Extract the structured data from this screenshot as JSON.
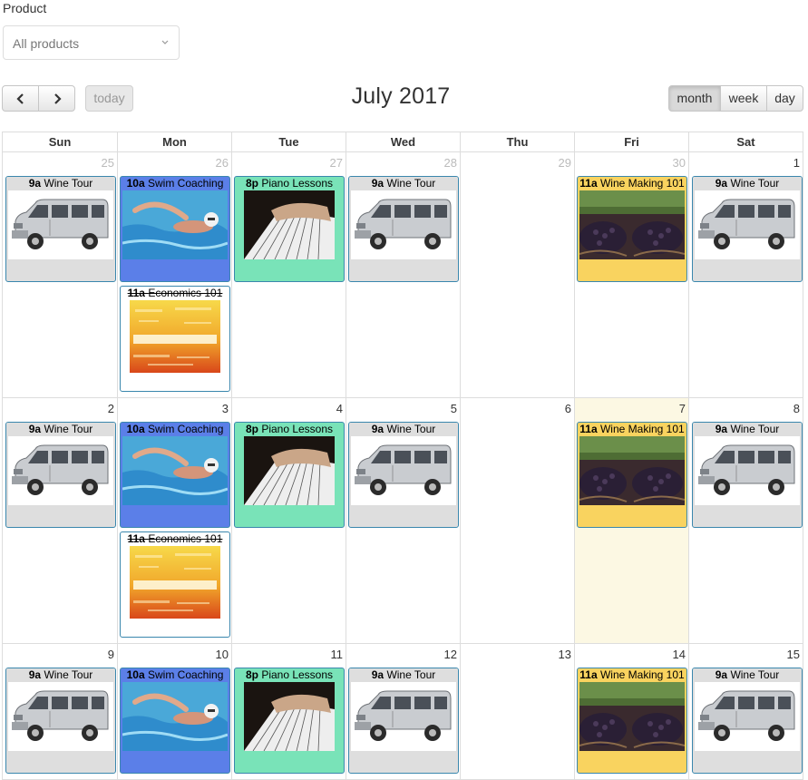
{
  "filter": {
    "label": "Product",
    "selected": "All products"
  },
  "toolbar": {
    "today_label": "today",
    "title": "July 2017",
    "views": {
      "month": "month",
      "week": "week",
      "day": "day"
    },
    "active_view": "month"
  },
  "day_headers": [
    "Sun",
    "Mon",
    "Tue",
    "Wed",
    "Thu",
    "Fri",
    "Sat"
  ],
  "weeks": [
    {
      "days": [
        {
          "num": "25",
          "other": true,
          "events": [
            {
              "kind": "wine",
              "time": "9a",
              "title": "Wine Tour"
            }
          ]
        },
        {
          "num": "26",
          "other": true,
          "events": [
            {
              "kind": "swim",
              "time": "10a",
              "title": "Swim Coaching"
            },
            {
              "kind": "econ",
              "time": "11a",
              "title": "Economics 101"
            }
          ]
        },
        {
          "num": "27",
          "other": true,
          "events": [
            {
              "kind": "piano",
              "time": "8p",
              "title": "Piano Lessons"
            }
          ]
        },
        {
          "num": "28",
          "other": true,
          "events": [
            {
              "kind": "wine",
              "time": "9a",
              "title": "Wine Tour"
            }
          ]
        },
        {
          "num": "29",
          "other": true,
          "events": []
        },
        {
          "num": "30",
          "other": true,
          "events": [
            {
              "kind": "winemaking",
              "time": "11a",
              "title": "Wine Making 101"
            }
          ]
        },
        {
          "num": "1",
          "other": false,
          "events": [
            {
              "kind": "wine",
              "time": "9a",
              "title": "Wine Tour"
            }
          ]
        }
      ]
    },
    {
      "days": [
        {
          "num": "2",
          "other": false,
          "events": [
            {
              "kind": "wine",
              "time": "9a",
              "title": "Wine Tour"
            }
          ]
        },
        {
          "num": "3",
          "other": false,
          "events": [
            {
              "kind": "swim",
              "time": "10a",
              "title": "Swim Coaching"
            },
            {
              "kind": "econ",
              "time": "11a",
              "title": "Economics 101"
            }
          ]
        },
        {
          "num": "4",
          "other": false,
          "events": [
            {
              "kind": "piano",
              "time": "8p",
              "title": "Piano Lessons"
            }
          ]
        },
        {
          "num": "5",
          "other": false,
          "events": [
            {
              "kind": "wine",
              "time": "9a",
              "title": "Wine Tour"
            }
          ]
        },
        {
          "num": "6",
          "other": false,
          "events": []
        },
        {
          "num": "7",
          "other": false,
          "today": true,
          "events": [
            {
              "kind": "winemaking",
              "time": "11a",
              "title": "Wine Making 101"
            }
          ]
        },
        {
          "num": "8",
          "other": false,
          "events": [
            {
              "kind": "wine",
              "time": "9a",
              "title": "Wine Tour"
            }
          ]
        }
      ]
    },
    {
      "days": [
        {
          "num": "9",
          "other": false,
          "events": [
            {
              "kind": "wine",
              "time": "9a",
              "title": "Wine Tour"
            }
          ]
        },
        {
          "num": "10",
          "other": false,
          "events": [
            {
              "kind": "swim",
              "time": "10a",
              "title": "Swim Coaching"
            }
          ]
        },
        {
          "num": "11",
          "other": false,
          "events": [
            {
              "kind": "piano",
              "time": "8p",
              "title": "Piano Lessons"
            }
          ]
        },
        {
          "num": "12",
          "other": false,
          "events": [
            {
              "kind": "wine",
              "time": "9a",
              "title": "Wine Tour"
            }
          ]
        },
        {
          "num": "13",
          "other": false,
          "events": []
        },
        {
          "num": "14",
          "other": false,
          "events": [
            {
              "kind": "winemaking",
              "time": "11a",
              "title": "Wine Making 101"
            }
          ]
        },
        {
          "num": "15",
          "other": false,
          "events": [
            {
              "kind": "wine",
              "time": "9a",
              "title": "Wine Tour"
            }
          ]
        }
      ]
    }
  ],
  "colors": {
    "wine_tour": "#dedede",
    "swim_coaching": "#5b7fe8",
    "piano_lessons": "#79e3b8",
    "wine_making": "#f9d35f",
    "economics": "#ffffff",
    "today_highlight": "#fcf8e3",
    "event_border": "#3a87ad"
  },
  "icons": {
    "prev": "chevron-left-icon",
    "next": "chevron-right-icon",
    "select": "chevron-down-icon"
  }
}
